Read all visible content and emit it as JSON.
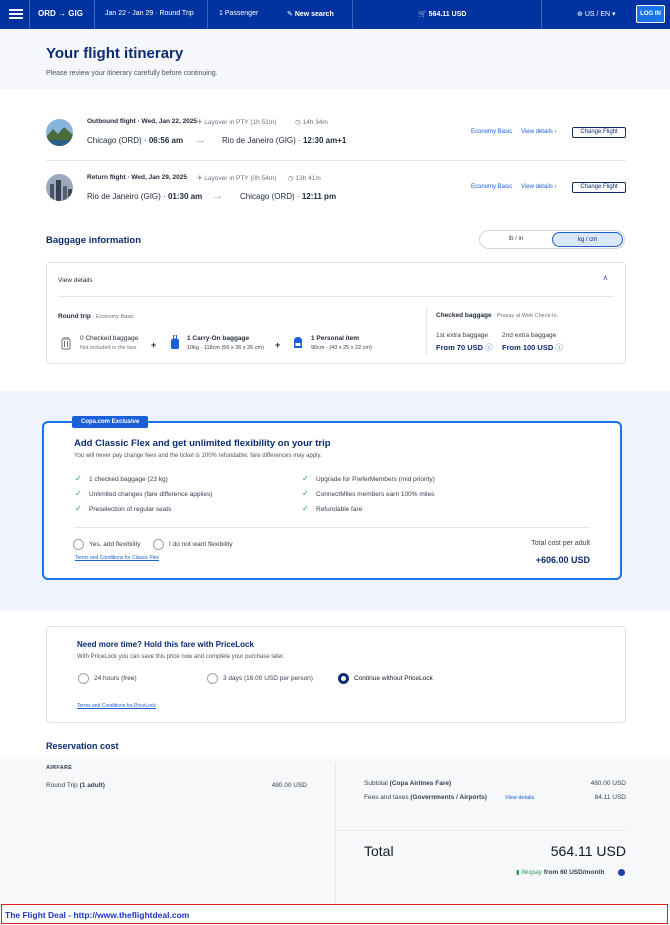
{
  "header": {
    "route_from": "ORD",
    "route_to": "GIG",
    "dates": "Jan 22 - Jan 29 · Round Trip",
    "passengers": "1 Passenger",
    "new_search": "New search",
    "cart_total": "564.11 USD",
    "locale": "US / EN",
    "login": "LOG IN"
  },
  "page": {
    "title": "Your flight itinerary",
    "subtitle": "Please review your itinerary carefully before continuing."
  },
  "outbound": {
    "heading": "Outbound flight · Wed, Jan 22, 2025",
    "layover": "Layover in PTY (1h 51m)",
    "duration": "14h 34m",
    "origin": "Chicago (ORD) ·",
    "origin_time": "06:56 am",
    "destination": "Rio de Janeiro (GIG) ·",
    "destination_time": "12:30 am+1",
    "fare": "Economy Basic",
    "view_details": "View details",
    "change": "Change Flight"
  },
  "return": {
    "heading": "Return flight · Wed, Jan 29, 2025",
    "layover": "Layover in PTY (0h 54m)",
    "duration": "13h 41m",
    "origin": "Rio de Janeiro (GIG) ·",
    "origin_time": "01:30 am",
    "destination": "Chicago (ORD) ·",
    "destination_time": "12:11 pm",
    "fare": "Economy Basic",
    "view_details": "View details",
    "change": "Change Flight"
  },
  "baggage": {
    "title": "Baggage information",
    "unit_lb": "lb / in",
    "unit_kg": "kg / cm",
    "view_details": "View details",
    "round_trip": "Round trip",
    "round_trip_fare": "· Economy Basic",
    "checked_title": "0 Checked baggage",
    "checked_sub": "Not included in the fare",
    "carry_title": "1 Carry-On baggage",
    "carry_sub": "10kg · 118cm (56 x 36 x 26 cm)",
    "personal_title": "1 Personal item",
    "personal_sub": "90cm · (43 x 25 x 22 cm)",
    "checked_right_title": "Checked baggage",
    "checked_right_sub": "· Prepay at Web Check-In.",
    "extra1_label": "1st extra baggage",
    "extra1_price": "From 70 USD",
    "extra2_label": "2nd extra baggage",
    "extra2_price": "From 100 USD"
  },
  "flex": {
    "badge": "Copa.com Exclusive",
    "title": "Add Classic Flex and get unlimited flexibility on your trip",
    "subtitle": "You will never pay change fees and the ticket is 100% refundable; fare differences may apply.",
    "benefits_left": [
      "1 checked baggage (23 kg)",
      "Unlimited changes (fare difference applies)",
      "Preselection of regular seats"
    ],
    "benefits_right": [
      "Upgrade for PreferMembers (mid priority)",
      "ConnectMiles members earn 100% miles",
      "Refundable fare"
    ],
    "option_yes": "Yes, add flexibility",
    "option_no": "I do not want flexibility",
    "terms": "Terms and Conditions for Classic Flex",
    "total_label": "Total cost per adult",
    "total_value": "+606.00 USD"
  },
  "pricelock": {
    "title": "Need more time? Hold this fare with PriceLock",
    "subtitle": "With PriceLock you can save this price now and complete your purchase later.",
    "opt1": "24 hours (free)",
    "opt2": "3 days (16.00 USD per person)",
    "opt3": "Continue without PriceLock",
    "terms": "Terms and Conditions for PriceLock"
  },
  "reservation": {
    "title": "Reservation cost",
    "airfare_label": "AIRFARE",
    "roundtrip_label": "Round Trip",
    "roundtrip_adult": "(1 adult)",
    "roundtrip_value": "480.00 USD",
    "subtotal_label": "Subtotal",
    "subtotal_detail": "(Copa Airlines Fare)",
    "subtotal_value": "480.00 USD",
    "fees_label": "Fees and taxes",
    "fees_detail": "(Governments / Airports)",
    "fees_link": "View details",
    "fees_value": "84.11 USD",
    "total_label": "Total",
    "total_value": "564.11 USD",
    "flexpay_brand": "flexpay",
    "flexpay_text": "from 60 USD/month"
  },
  "footer": {
    "text": "The Flight Deal - http://www.theflightdeal.com"
  }
}
